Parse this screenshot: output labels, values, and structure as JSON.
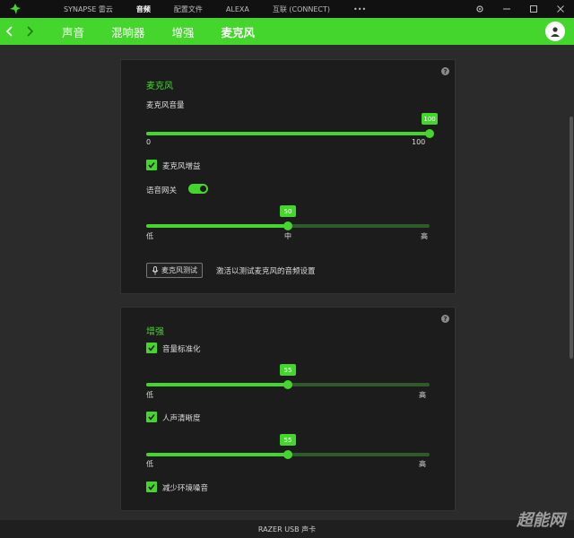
{
  "titlebar": {
    "nav": [
      "SYNAPSE 雷云",
      "音频",
      "配置文件",
      "ALEXA",
      "互联 (CONNECT)",
      "•••"
    ],
    "active_index": 1
  },
  "subnav": {
    "tabs": [
      "声音",
      "混响器",
      "增强",
      "麦克风"
    ],
    "active_index": 3
  },
  "mic_card": {
    "title": "麦克风",
    "volume_label": "麦克风音量",
    "volume_value": "100",
    "volume_min": "0",
    "volume_max": "100",
    "volume_level": 1.0,
    "gain_label": "麦克风增益",
    "gain_checked": true,
    "gate_label": "语音网关",
    "gate_on": true,
    "gate_value": "50",
    "gate_level": 0.5,
    "gate_low": "低",
    "gate_mid": "中",
    "gate_high": "高",
    "test_button": "麦克风测试",
    "test_hint": "激活以测试麦克风的音频设置"
  },
  "enhance_card": {
    "title": "增强",
    "normalize_label": "音量标准化",
    "normalize_checked": true,
    "normalize_value": "55",
    "normalize_level": 0.5,
    "normalize_low": "低",
    "normalize_high": "高",
    "clarity_label": "人声清晰度",
    "clarity_checked": true,
    "clarity_value": "55",
    "clarity_level": 0.5,
    "clarity_low": "低",
    "clarity_high": "高",
    "noise_label": "减少环境噪音",
    "noise_checked": true
  },
  "footer": {
    "device": "RAZER USB 声卡"
  },
  "watermark": "超能网",
  "colors": {
    "accent": "#44d62c",
    "background": "#2b2b2b",
    "card": "#1c1c1c"
  }
}
